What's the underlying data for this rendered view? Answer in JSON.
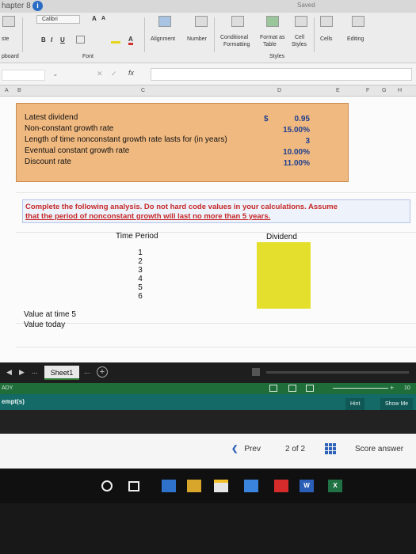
{
  "title_bar": {
    "document": "hapter 8",
    "status": "Saved"
  },
  "ribbon": {
    "font_name": "Calibri",
    "bold": "B",
    "italic": "I",
    "underline": "U",
    "font_a_large": "A",
    "font_a_small": "A",
    "alignment": "Alignment",
    "number": "Number",
    "conditional_formatting": [
      "Conditional",
      "Formatting"
    ],
    "format_as_table": [
      "Format as",
      "Table"
    ],
    "cell_styles": [
      "Cell",
      "Styles"
    ],
    "styles_group": "Styles",
    "cells": "Cells",
    "editing": "Editing",
    "paste": "ste",
    "clipboard": "pboard",
    "font_group": "Font",
    "fx": "fx"
  },
  "columns": [
    "A",
    "B",
    "C",
    "D",
    "E",
    "F",
    "G",
    "H"
  ],
  "inputs": {
    "rows": [
      {
        "label": "Latest dividend",
        "value": "0.95",
        "prefix": "$"
      },
      {
        "label": "Non-constant growth rate",
        "value": "15.00%"
      },
      {
        "label": "Length of time nonconstant growth rate lasts for (in years)",
        "value": "3"
      },
      {
        "label": "Eventual constant growth rate",
        "value": "10.00%"
      },
      {
        "label": "Discount rate",
        "value": "11.00%"
      }
    ]
  },
  "instruction": {
    "line1": "Complete the following analysis. Do not hard code values in your calculations. Assume",
    "line2": "that the period of nonconstant growth will last no more than 5 years."
  },
  "table": {
    "period_header": "Time Period",
    "dividend_header": "Dividend",
    "periods": [
      "1",
      "2",
      "3",
      "4",
      "5",
      "6"
    ]
  },
  "value_labels": {
    "time5": "Value at time 5",
    "today": "Value today"
  },
  "sheet_tabs": {
    "active": "Sheet1",
    "more": "...",
    "add": "+"
  },
  "status_bar": {
    "ready": "ADY",
    "zoom": "10"
  },
  "assignment_bar": {
    "attempts": "empt(s)",
    "hint": "Hint",
    "show_me": "Show Me"
  },
  "navigation": {
    "prev": "Prev",
    "page": "2",
    "of": "of",
    "total": "2",
    "score": "Score answer"
  },
  "colors": {
    "input_fill": "#f0b980",
    "answer_fill": "#e4df2c",
    "instruction_text": "#c62828",
    "value_text": "#1f3f8f",
    "status_green": "#1f6e3a",
    "teal": "#136a67"
  }
}
